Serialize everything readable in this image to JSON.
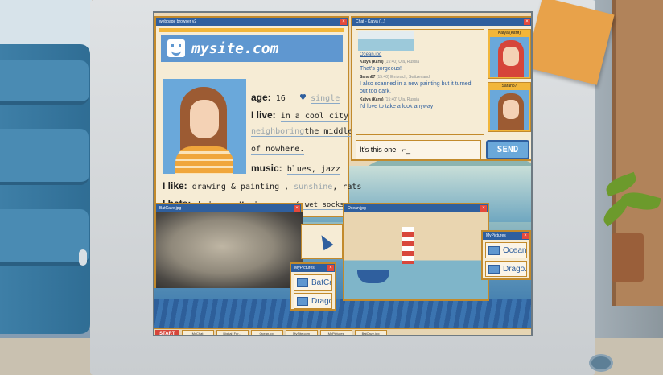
{
  "colors": {
    "accent": "#2f5f9e",
    "window_border": "#c28a2c",
    "brand_blue": "#5f97d0",
    "close": "#e5483b",
    "start": "#d6453a"
  },
  "browser": {
    "title": "webpage browser v2",
    "site_name": "mysite.com",
    "profile": {
      "age_label": "age:",
      "age_value": "16",
      "relationship": "single",
      "live_label": "I live:",
      "live_value_1": "in a cool city",
      "live_crossed": "neighboring",
      "live_value_2": "the middle",
      "live_value_3": "of nowhere.",
      "music_label": "music:",
      "music_value": "blues, jazz",
      "like_label": "I like:",
      "like_value_1": "drawing & painting",
      "like_crossed": "sunshine",
      "like_value_2": "rats",
      "hate_label": "I hate:",
      "hate_value": "darkness, Mondays, war & wet socks"
    }
  },
  "chat": {
    "title": "Chat - Katya (...)",
    "attachment": "Ocean.jpg",
    "messages": [
      {
        "author": "Katya (Катя)",
        "meta": "(15:40) Ufa, Russia",
        "text": "That's gorgeous!"
      },
      {
        "author": "Sarah87",
        "meta": "(15:40) Embrach, Switzerland",
        "text": "I also scanned in a new painting but it turned out too dark."
      },
      {
        "author": "Katya (Катя)",
        "meta": "(15:40) Ufa, Russia",
        "text": "I'd love to take a look anyway"
      }
    ],
    "avatars": [
      {
        "name": "Katya (Катя)",
        "hair": "#d6453a"
      },
      {
        "name": "Sarah87",
        "hair": "#9c5b33"
      }
    ],
    "compose_text": "It's this one:",
    "send_label": "SEND"
  },
  "batcave": {
    "title": "BatCave.jpg"
  },
  "ocean_window": {
    "title": "Ocean.jpg"
  },
  "files_left": {
    "title": "MyPictures",
    "items": [
      "BatCa...",
      "Drago..."
    ]
  },
  "files_right": {
    "title": "MyPictures",
    "items": [
      "Ocean...",
      "Drago..."
    ]
  },
  "taskbar": {
    "start": "START",
    "tasks": [
      "MyChat",
      "Digital_Fer...",
      "Ocean.jpg",
      "MySite.com",
      "MyPictures",
      "BatCave.jpg"
    ]
  }
}
